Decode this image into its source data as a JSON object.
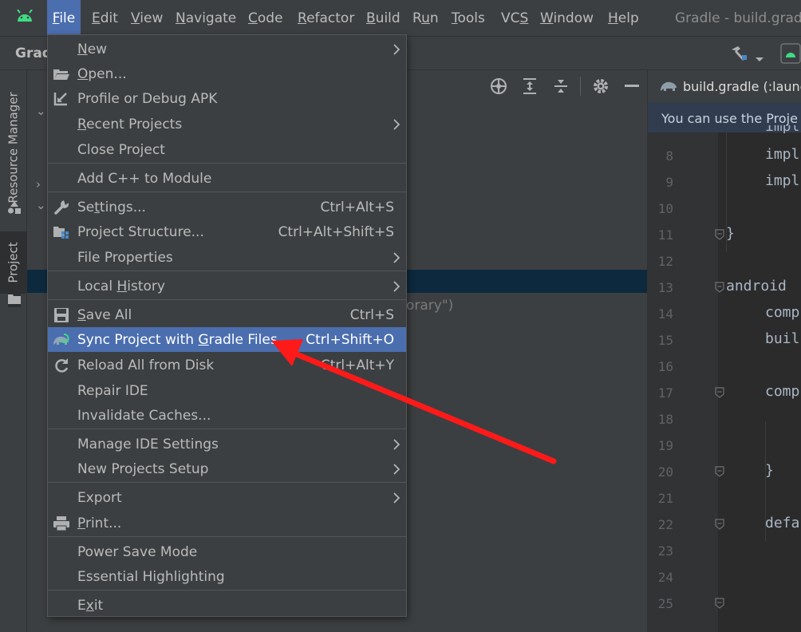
{
  "menubar": {
    "items": [
      {
        "label": "File",
        "mnemonic": "F"
      },
      {
        "label": "Edit",
        "mnemonic": "E"
      },
      {
        "label": "View",
        "mnemonic": "V"
      },
      {
        "label": "Navigate",
        "mnemonic": "N"
      },
      {
        "label": "Code",
        "mnemonic": "C"
      },
      {
        "label": "Refactor",
        "mnemonic": "R"
      },
      {
        "label": "Build",
        "mnemonic": "B"
      },
      {
        "label": "Run",
        "mnemonic": "u"
      },
      {
        "label": "Tools",
        "mnemonic": "T"
      },
      {
        "label": "VCS",
        "mnemonic": "S"
      },
      {
        "label": "Window",
        "mnemonic": "W"
      },
      {
        "label": "Help",
        "mnemonic": "H"
      }
    ],
    "window_title": "Gradle - build.gradl"
  },
  "toolbar": {
    "breadcrumb": "Grad"
  },
  "left_strip": {
    "resource_manager": "Resource Manager",
    "project": "Project"
  },
  "project_panel": {
    "partial_text": "orary\")"
  },
  "editor": {
    "tab_label": "build.gradle (:launc",
    "banner": "You can use the Proje",
    "lines": [
      {
        "n": "8",
        "code": "impl"
      },
      {
        "n": "9",
        "code": "impl"
      },
      {
        "n": "10",
        "code": ""
      },
      {
        "n": "11",
        "code": "}"
      },
      {
        "n": "12",
        "code": ""
      },
      {
        "n": "13",
        "code": "android"
      },
      {
        "n": "14",
        "code": "comp"
      },
      {
        "n": "15",
        "code": "buil"
      },
      {
        "n": "16",
        "code": ""
      },
      {
        "n": "17",
        "code": "comp"
      },
      {
        "n": "18",
        "code": ""
      },
      {
        "n": "19",
        "code": ""
      },
      {
        "n": "20",
        "code": "}"
      },
      {
        "n": "21",
        "code": ""
      },
      {
        "n": "22",
        "code": "defa"
      },
      {
        "n": "23",
        "code": ""
      },
      {
        "n": "24",
        "code": ""
      },
      {
        "n": "25",
        "code": ""
      }
    ]
  },
  "file_menu": {
    "items": [
      {
        "label": "New",
        "mnemonic": "N",
        "submenu": true
      },
      {
        "label": "Open...",
        "mnemonic": "O",
        "icon": "folder-open-icon"
      },
      {
        "label": "Profile or Debug APK",
        "icon": "profile-apk-icon"
      },
      {
        "label": "Recent Projects",
        "mnemonic": "R",
        "submenu": true
      },
      {
        "label": "Close Project"
      },
      {
        "label": "Add C++ to Module"
      },
      {
        "label": "Settings...",
        "mnemonic": "t",
        "shortcut": "Ctrl+Alt+S",
        "icon": "wrench-icon"
      },
      {
        "label": "Project Structure...",
        "shortcut": "Ctrl+Alt+Shift+S",
        "icon": "project-structure-icon"
      },
      {
        "label": "File Properties",
        "submenu": true
      },
      {
        "label": "Local History",
        "mnemonic": "H",
        "submenu": true
      },
      {
        "label": "Save All",
        "mnemonic": "S",
        "shortcut": "Ctrl+S",
        "icon": "save-icon"
      },
      {
        "label": "Sync Project with Gradle Files",
        "mnemonic": "G",
        "shortcut": "Ctrl+Shift+O",
        "icon": "gradle-sync-icon",
        "highlighted": true
      },
      {
        "label": "Reload All from Disk",
        "shortcut": "Ctrl+Alt+Y",
        "icon": "reload-icon"
      },
      {
        "label": "Repair IDE"
      },
      {
        "label": "Invalidate Caches..."
      },
      {
        "label": "Manage IDE Settings",
        "submenu": true
      },
      {
        "label": "New Projects Setup",
        "submenu": true
      },
      {
        "label": "Export",
        "submenu": true
      },
      {
        "label": "Print...",
        "mnemonic": "P",
        "icon": "print-icon"
      },
      {
        "label": "Power Save Mode"
      },
      {
        "label": "Essential Highlighting"
      },
      {
        "label": "Exit",
        "mnemonic": "x"
      }
    ]
  },
  "annotation": {
    "arrow_color": "#ff1a1a"
  },
  "colors": {
    "highlight": "#4b6eaf",
    "menu_bg": "#3c3f41",
    "editor_bg": "#2b2b2b",
    "android_green": "#3ddc84"
  }
}
